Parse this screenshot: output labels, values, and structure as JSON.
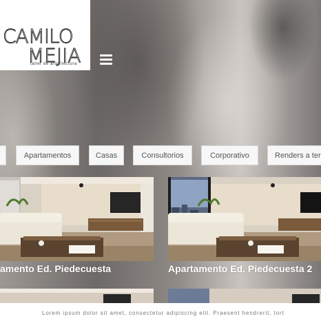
{
  "logo": {
    "line1": "CAMILO",
    "line2": "MEJIA",
    "tagline": "taller de arquitectura"
  },
  "header": {
    "menu_icon": "hamburger-menu-icon"
  },
  "filters": [
    {
      "label": ""
    },
    {
      "label": "Apartamentos"
    },
    {
      "label": "Casas"
    },
    {
      "label": "Consultorios"
    },
    {
      "label": "Corporativo"
    },
    {
      "label": "Renders a terc"
    }
  ],
  "projects": [
    {
      "title": "amento Ed. Piedecuesta"
    },
    {
      "title": "Apartamento Ed. Piedecuesta 2"
    }
  ],
  "footer": {
    "text": "Lorem ipsum dolor sit amet, consectetur adipiscing elit. Praesent hendrerit, tort"
  }
}
